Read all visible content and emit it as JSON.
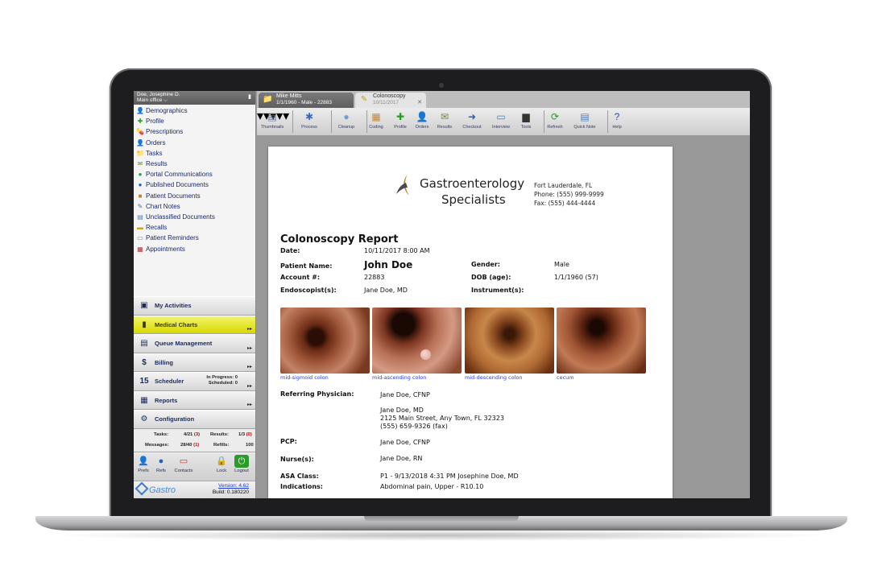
{
  "sidebar": {
    "user": "Doe, Josephine D.",
    "office": "Main office",
    "nav_items": [
      {
        "label": "Demographics",
        "icon": "person-icon",
        "glyph": "👤",
        "color": "#b05020"
      },
      {
        "label": "Profile",
        "icon": "plus-icon",
        "glyph": "✚",
        "color": "#22a022"
      },
      {
        "label": "Prescriptions",
        "icon": "pill-icon",
        "glyph": "💊",
        "color": "#c03030"
      },
      {
        "label": "Orders",
        "icon": "orders-icon",
        "glyph": "👤",
        "color": "#b05020"
      },
      {
        "label": "Tasks",
        "icon": "folder-icon",
        "glyph": "📁",
        "color": "#d8a020"
      },
      {
        "label": "Results",
        "icon": "results-icon",
        "glyph": "✉",
        "color": "#6a8a30"
      },
      {
        "label": "Portal Communications",
        "icon": "portal-icon",
        "glyph": "●",
        "color": "#20a040"
      },
      {
        "label": "Published Documents",
        "icon": "published-icon",
        "glyph": "●",
        "color": "#2060c0"
      },
      {
        "label": "Patient Documents",
        "icon": "patient-docs-icon",
        "glyph": "■",
        "color": "#c08040"
      },
      {
        "label": "Chart Notes",
        "icon": "notes-icon",
        "glyph": "✎",
        "color": "#5070a0"
      },
      {
        "label": "Unclassified Documents",
        "icon": "unclassified-icon",
        "glyph": "▤",
        "color": "#6080b0"
      },
      {
        "label": "Recalls",
        "icon": "recalls-icon",
        "glyph": "▬",
        "color": "#d0a020"
      },
      {
        "label": "Patient Reminders",
        "icon": "reminders-icon",
        "glyph": "▭",
        "color": "#909090"
      },
      {
        "label": "Appointments",
        "icon": "calendar-icon",
        "glyph": "▦",
        "color": "#c03030"
      }
    ],
    "modules": [
      {
        "label": "My Activities",
        "icon": "activities-icon",
        "glyph": "▣",
        "active": false,
        "arrows": false
      },
      {
        "label": "Medical Charts",
        "icon": "charts-icon",
        "glyph": "▮",
        "active": true,
        "arrows": true
      },
      {
        "label": "Queue Management",
        "icon": "queue-icon",
        "glyph": "▤",
        "active": false,
        "arrows": true
      },
      {
        "label": "Billing",
        "icon": "billing-icon",
        "glyph": "$",
        "active": false,
        "arrows": true
      },
      {
        "label": "Scheduler",
        "icon": "scheduler-icon",
        "glyph": "15",
        "active": false,
        "arrows": true
      },
      {
        "label": "Reports",
        "icon": "reports-icon",
        "glyph": "▦",
        "active": false,
        "arrows": true
      },
      {
        "label": "Configuration",
        "icon": "config-icon",
        "glyph": "⚙",
        "active": false,
        "arrows": false
      }
    ],
    "scheduler_in_progress": "In Progress: 0",
    "scheduler_scheduled": "Scheduled: 0",
    "stats": {
      "tasks_label": "Tasks:",
      "tasks_value": "4/21",
      "tasks_red": "(3)",
      "results_label": "Results:",
      "results_value": "1/3",
      "results_red": "(0)",
      "messages_label": "Messages:",
      "messages_value": "28/40",
      "messages_red": "(1)",
      "refills_label": "Refills:",
      "refills_value": "100"
    },
    "bottom_buttons": [
      "Prefs",
      "Refs",
      "Contacts",
      "Lock",
      "Logout"
    ],
    "brand": "Gastro",
    "version": "Version: 4.62",
    "build": "Build: 0.180220"
  },
  "tabs": [
    {
      "title": "Mike Mitts",
      "sub": "1/1/1960 - Male - 22883"
    },
    {
      "title": "Colonoscopy",
      "sub": "10/11/2017"
    }
  ],
  "toolbar": [
    "Thumbnails",
    "Process",
    "Cleanup",
    "Coding",
    "Profile",
    "Orders",
    "Results",
    "Checkout",
    "Interview",
    "Tools",
    "Refresh",
    "Quick Note",
    "Help"
  ],
  "report": {
    "clinic_line1": "Gastroenterology",
    "clinic_line2": "Specialists",
    "clinic_city": "Fort Lauderdale, FL",
    "clinic_phone": "Phone: (555) 999-9999",
    "clinic_fax": "Fax: (555) 444-4444",
    "title": "Colonoscopy Report",
    "date_label": "Date:",
    "date_value": "10/11/2017 8:00 AM",
    "patient_label": "Patient Name:",
    "patient_value": "John Doe",
    "gender_label": "Gender:",
    "gender_value": "Male",
    "account_label": "Account #:",
    "account_value": "22883",
    "dob_label": "DOB (age):",
    "dob_value": "1/1/1960 (57)",
    "endoscopist_label": "Endoscopist(s):",
    "endoscopist_value": "Jane Doe, MD",
    "instrument_label": "Instrument(s):",
    "images": [
      "mid-sigmoid colon",
      "mid-ascending colon",
      "mid-descending colon",
      "cecum"
    ],
    "referring_label": "Referring Physician:",
    "referring_value": "Jane Doe, CFNP",
    "referring_md": "Jane Doe, MD",
    "referring_address": "2125 Main Street, Any Town, FL 32323",
    "referring_fax": "(555) 659-9326 (fax)",
    "pcp_label": "PCP:",
    "pcp_value": "Jane Doe, CFNP",
    "nurse_label": "Nurse(s):",
    "nurse_value": "Jane Doe, RN",
    "asa_label": "ASA Class:",
    "asa_value": "P1 - 9/13/2018 4:31 PM Josephine Doe, MD",
    "indications_label": "Indications:",
    "indications_value": "Abdominal pain, Upper - R10.10"
  }
}
